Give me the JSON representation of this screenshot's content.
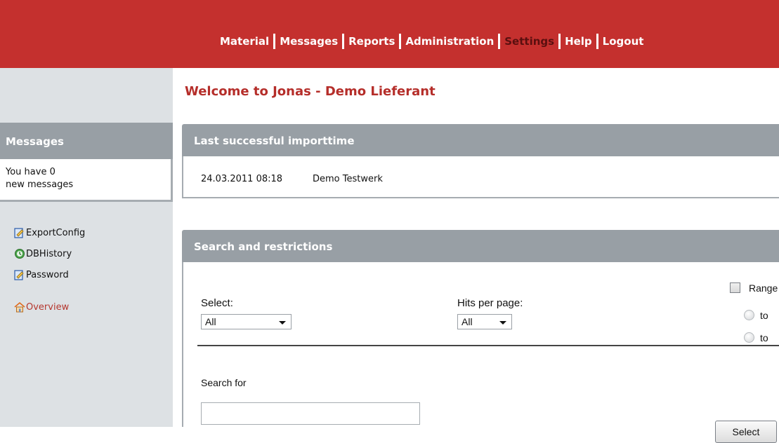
{
  "colors": {
    "brand_red": "#c4302e",
    "active_nav": "#5a0f0f",
    "panel_header_gray": "#989fa5",
    "sidebar_bg": "#dde1e4",
    "welcome_text": "#b52e2a"
  },
  "nav": {
    "items": [
      {
        "label": "Material",
        "active": false
      },
      {
        "label": "Messages",
        "active": false
      },
      {
        "label": "Reports",
        "active": false
      },
      {
        "label": "Administration",
        "active": false
      },
      {
        "label": "Settings",
        "active": true
      },
      {
        "label": "Help",
        "active": false
      },
      {
        "label": "Logout",
        "active": false
      }
    ]
  },
  "welcome": "Welcome to Jonas - Demo Lieferant",
  "sidebar": {
    "messages_header": "Messages",
    "messages_line1": "You have 0",
    "messages_line2": "new messages",
    "links": [
      {
        "label": "ExportConfig",
        "icon": "edit-document-icon"
      },
      {
        "label": "DBHistory",
        "icon": "history-icon"
      },
      {
        "label": "Password",
        "icon": "edit-document-icon"
      }
    ],
    "overview": {
      "label": "Overview",
      "icon": "home-icon"
    }
  },
  "import_panel": {
    "header": "Last successful importtime",
    "date": "24.03.2011 08:18",
    "plant": "Demo Testwerk"
  },
  "search_panel": {
    "header": "Search and restrictions",
    "select_label": "Select:",
    "select_value": "All",
    "hits_label": "Hits per page:",
    "hits_value": "All",
    "range_label": "Range",
    "range_options": [
      "to",
      "to"
    ],
    "search_for_label": "Search for",
    "search_value": "",
    "select_button": "Select"
  }
}
